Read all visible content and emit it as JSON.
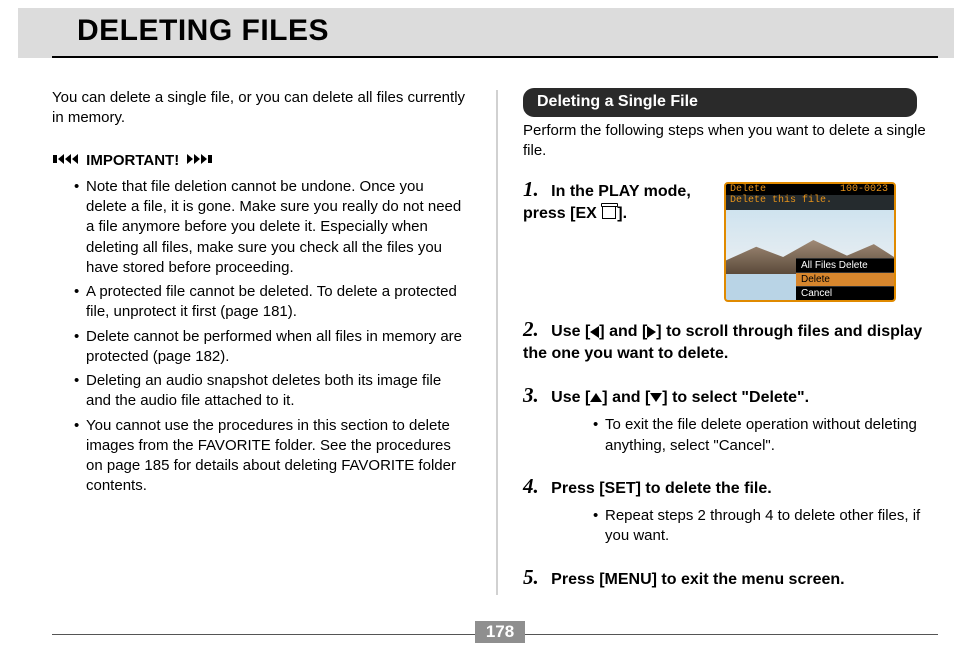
{
  "page": {
    "title": "DELETING FILES",
    "number": "178",
    "intro": "You can delete a single file, or you can delete all files currently in memory.",
    "important_label": "IMPORTANT!",
    "important_items": [
      "Note that file deletion cannot be undone. Once you delete a file, it is gone. Make sure you really do not need a file anymore before you delete it. Especially when deleting all files, make sure you check all the files you have stored before proceeding.",
      "A protected file cannot be deleted. To delete a protected file, unprotect it first (page 181).",
      "Delete cannot be performed when all files in memory are protected (page 182).",
      "Deleting an audio snapshot deletes both its image file and the audio file attached to it.",
      "You cannot use the procedures in this section to delete images from the FAVORITE folder. See the procedures on page 185 for details about deleting FAVORITE folder contents."
    ]
  },
  "section": {
    "heading": "Deleting a Single File",
    "sub": "Perform the following steps when you want to delete a single file.",
    "steps": [
      {
        "n": "1.",
        "body_pre": "In the PLAY mode, press [EX ",
        "body_post": "].",
        "subs": []
      },
      {
        "n": "2.",
        "body": "Use [◀] and [▶] to scroll through files and display the one you want to delete.",
        "subs": []
      },
      {
        "n": "3.",
        "body": "Use [▲] and [▼] to select \"Delete\".",
        "subs": [
          "To exit the file delete operation without deleting anything, select \"Cancel\"."
        ]
      },
      {
        "n": "4.",
        "body": "Press [SET] to delete the file.",
        "subs": [
          "Repeat steps 2 through 4 to delete other files, if you want."
        ]
      },
      {
        "n": "5.",
        "body": "Press [MENU] to exit the menu screen.",
        "subs": []
      }
    ]
  },
  "screenshot": {
    "top_label": "Delete",
    "top_caption": "Delete this file.",
    "file_id": "100-0023",
    "menu": [
      "All Files Delete",
      "Delete",
      "Cancel"
    ],
    "menu_selected": 1
  }
}
